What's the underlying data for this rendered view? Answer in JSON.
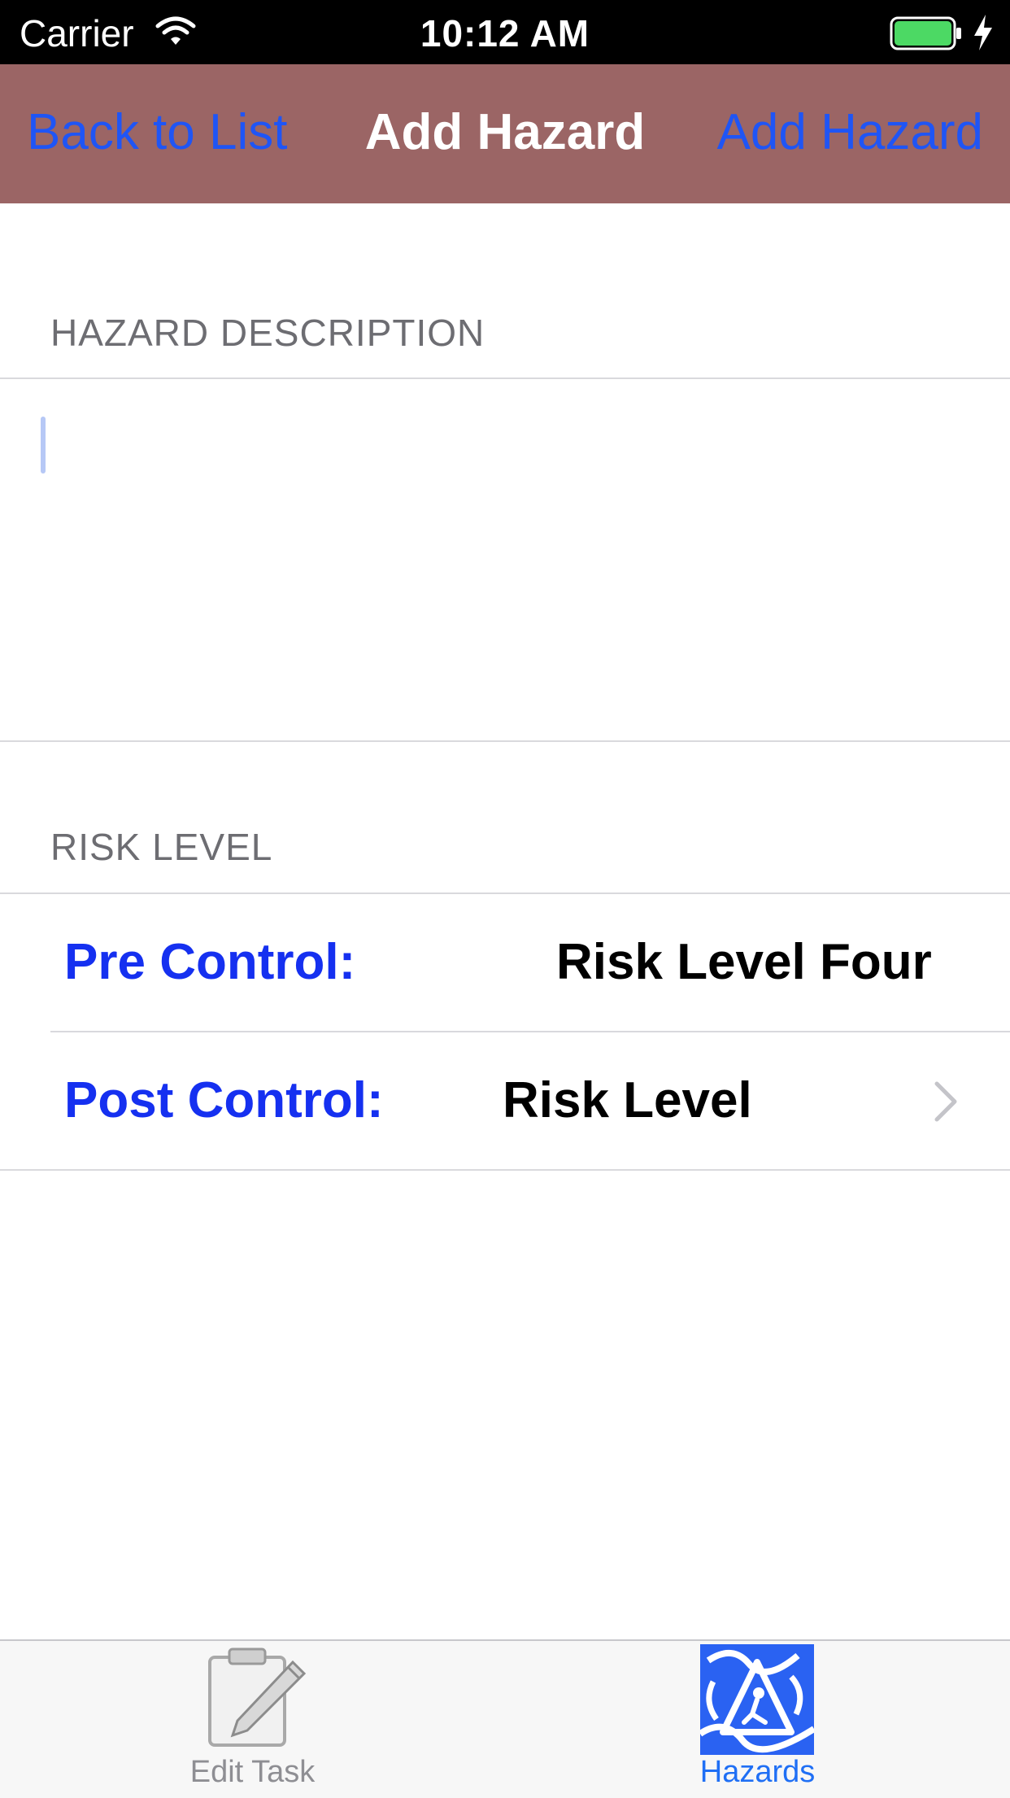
{
  "status_bar": {
    "carrier": "Carrier",
    "time": "10:12 AM",
    "battery_color": "#4cd964"
  },
  "nav": {
    "back_label": "Back to List",
    "title": "Add Hazard",
    "action_label": "Add Hazard",
    "background": "#9b6565",
    "tint": "#1f55f5"
  },
  "description": {
    "header": "HAZARD DESCRIPTION",
    "value": ""
  },
  "risk": {
    "header": "RISK LEVEL",
    "pre_label": "Pre Control:",
    "pre_value": "Risk Level Four",
    "post_label": "Post Control:",
    "post_value": "Risk Level"
  },
  "tabs": [
    {
      "label": "Edit Task",
      "icon": "clipboard-pencil-icon",
      "selected": false
    },
    {
      "label": "Hazards",
      "icon": "hazard-warning-icon",
      "selected": true
    }
  ]
}
